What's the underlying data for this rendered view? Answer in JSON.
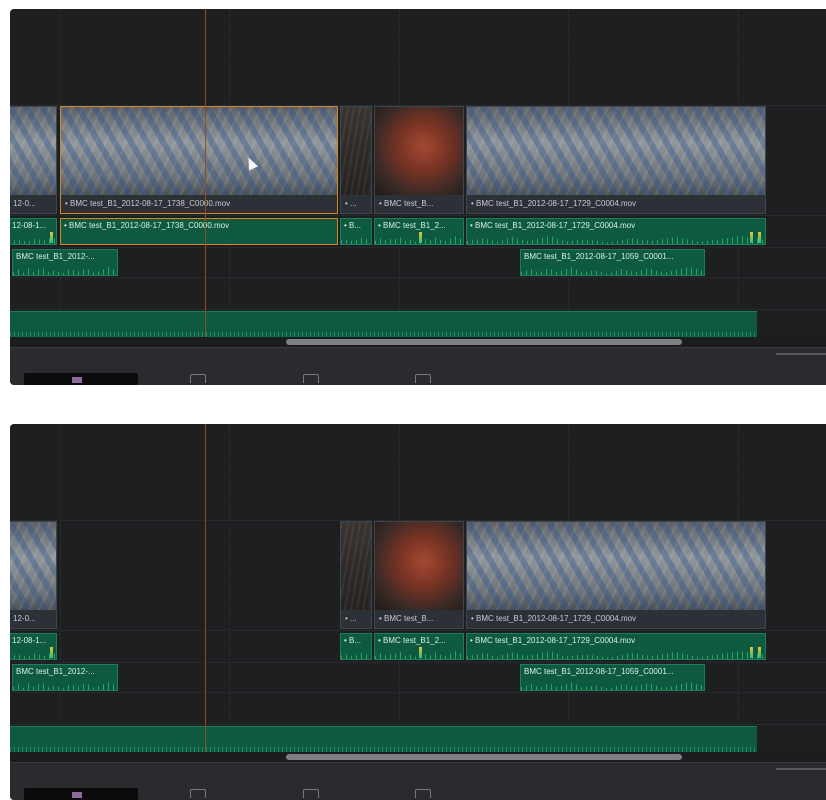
{
  "colors": {
    "panel_bg": "#1e1f21",
    "audio_clip": "#0d5a41",
    "video_label_bar": "#2b3136",
    "selection": "#d7851e",
    "playhead": "#9a4b12"
  },
  "panels": [
    {
      "id": "top",
      "video_clips": [
        {
          "label": "12-0..."
        },
        {
          "label": "• BMC test_B1_2012-08-17_1738_C0000.mov"
        },
        {
          "label": "• ..."
        },
        {
          "label": "• BMC test_B..."
        },
        {
          "label": "• BMC test_B1_2012-08-17_1729_C0004.mov"
        }
      ],
      "audio1_clips": [
        {
          "label": "12-08-1..."
        },
        {
          "label": "• BMC test_B1_2012-08-17_1738_C0000.mov"
        },
        {
          "label": "• B..."
        },
        {
          "label": "• BMC test_B1_2..."
        },
        {
          "label": "• BMC test_B1_2012-08-17_1729_C0004.mov"
        }
      ],
      "audio2_clips": [
        {
          "label": "BMC test_B1_2012-..."
        },
        {
          "label": "BMC test_B1_2012-08-17_1059_C0001..."
        }
      ]
    },
    {
      "id": "bottom",
      "video_clips": [
        {
          "label": "12-0..."
        },
        {
          "label": "• ..."
        },
        {
          "label": "• BMC test_B..."
        },
        {
          "label": "• BMC test_B1_2012-08-17_1729_C0004.mov"
        }
      ],
      "audio1_clips": [
        {
          "label": "12-08-1..."
        },
        {
          "label": "• B..."
        },
        {
          "label": "• BMC test_B1_2..."
        },
        {
          "label": "• BMC test_B1_2012-08-17_1729_C0004.mov"
        }
      ],
      "audio2_clips": [
        {
          "label": "BMC test_B1_2012-..."
        },
        {
          "label": "BMC test_B1_2012-08-17_1059_C0001..."
        }
      ]
    }
  ]
}
